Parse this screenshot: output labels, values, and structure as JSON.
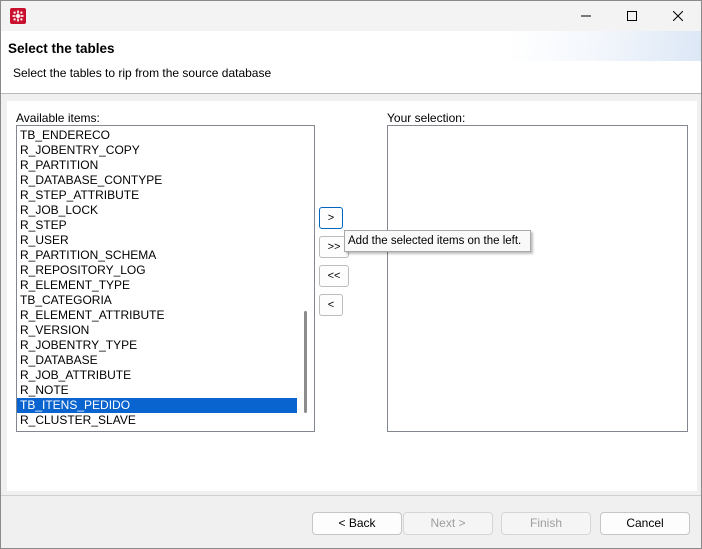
{
  "window": {
    "title": "",
    "controls": [
      "minimize-icon",
      "maximize-icon",
      "close-icon"
    ]
  },
  "header": {
    "title": "Select the tables",
    "description": "Select the tables to rip from the source database"
  },
  "available": {
    "label": "Available items:",
    "items": [
      "TB_ENDERECO",
      "R_JOBENTRY_COPY",
      "R_PARTITION",
      "R_DATABASE_CONTYPE",
      "R_STEP_ATTRIBUTE",
      "R_JOB_LOCK",
      "R_STEP",
      "R_USER",
      "R_PARTITION_SCHEMA",
      "R_REPOSITORY_LOG",
      "R_ELEMENT_TYPE",
      "TB_CATEGORIA",
      "R_ELEMENT_ATTRIBUTE",
      "R_VERSION",
      "R_JOBENTRY_TYPE",
      "R_DATABASE",
      "R_JOB_ATTRIBUTE",
      "R_NOTE",
      "TB_ITENS_PEDIDO",
      "R_CLUSTER_SLAVE"
    ],
    "selected_index": 18
  },
  "selection": {
    "label": "Your selection:",
    "items": []
  },
  "move_buttons": {
    "add": ">",
    "add_all": ">>",
    "remove_all": "<<",
    "remove": "<"
  },
  "tooltip": "Add the selected items on the left.",
  "footer": {
    "back": "< Back",
    "next": "Next >",
    "finish": "Finish",
    "cancel": "Cancel"
  },
  "colors": {
    "selection_highlight": "#0a64d0",
    "app_icon": "#c8102e"
  }
}
